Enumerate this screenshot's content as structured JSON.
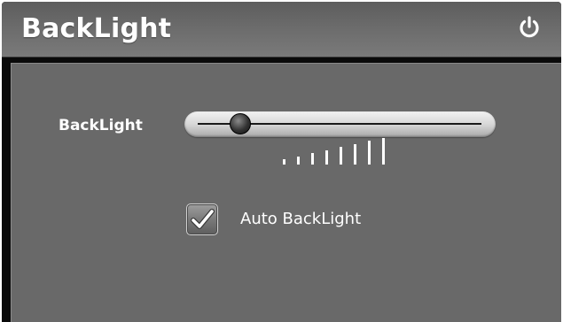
{
  "window": {
    "title": "BackLight"
  },
  "backlight": {
    "label": "BackLight",
    "level": 0.15,
    "level_bar_count": 8
  },
  "auto_backlight": {
    "label": "Auto BackLight",
    "checked": true
  },
  "icons": {
    "power": "power-icon",
    "check": "checkmark-icon"
  },
  "colors": {
    "titlebar": "#6b6b6b",
    "panel": "#696969",
    "text": "#ffffff"
  }
}
